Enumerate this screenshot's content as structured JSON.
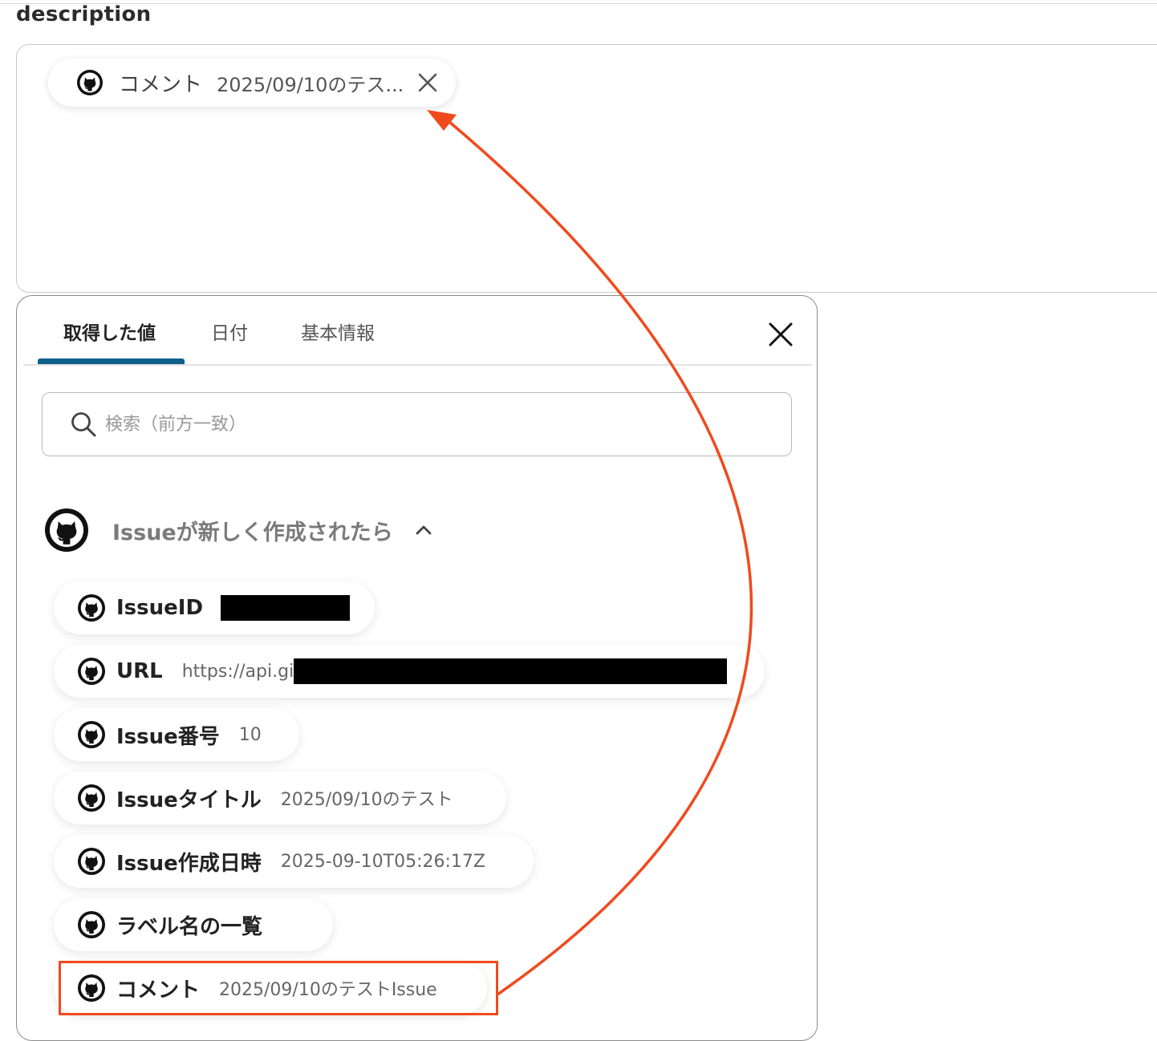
{
  "field": {
    "label": "description"
  },
  "token": {
    "icon": "github-icon",
    "name": "コメント",
    "value": "2025/09/10のテス..."
  },
  "panel": {
    "tabs": [
      {
        "label": "取得した値",
        "active": true
      },
      {
        "label": "日付",
        "active": false
      },
      {
        "label": "基本情報",
        "active": false
      }
    ],
    "search": {
      "placeholder": "検索（前方一致）",
      "value": ""
    },
    "group": {
      "icon": "github-icon",
      "title": "Issueが新しく作成されたら",
      "expanded": true
    },
    "items": [
      {
        "label": "IssueID",
        "value": "",
        "redacted": true
      },
      {
        "label": "URL",
        "value": "https://api.gi",
        "redacted": true
      },
      {
        "label": "Issue番号",
        "value": "10",
        "redacted": false
      },
      {
        "label": "Issueタイトル",
        "value": "2025/09/10のテスト",
        "redacted": false
      },
      {
        "label": "Issue作成日時",
        "value": "2025-09-10T05:26:17Z",
        "redacted": false
      },
      {
        "label": "ラベル名の一覧",
        "value": "",
        "redacted": false
      },
      {
        "label": "コメント",
        "value": "2025/09/10のテストIssue",
        "redacted": false,
        "highlighted": true
      }
    ]
  },
  "colors": {
    "accent": "#0e5f8b",
    "annotation": "#f04a1c"
  }
}
